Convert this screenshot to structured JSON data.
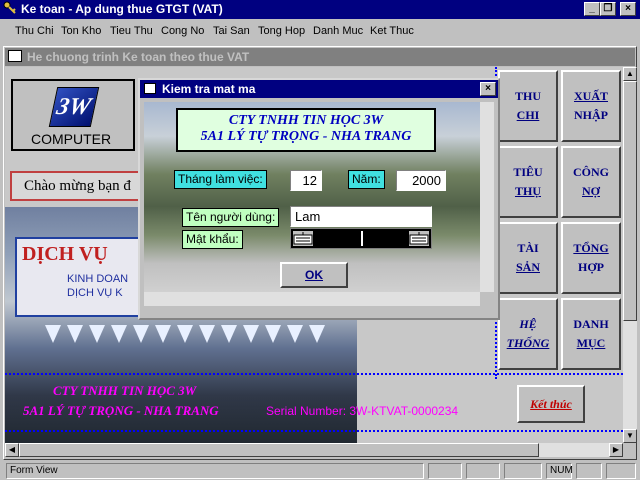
{
  "app": {
    "title": "Ke toan - Ap dung thue GTGT (VAT)"
  },
  "menu": [
    "Thu Chi",
    "Ton Kho",
    "Tieu Thu",
    "Cong No",
    "Tai San",
    "Tong Hop",
    "Danh Muc",
    "Ket Thuc"
  ],
  "form": {
    "title": "He chuong trinh Ke toan theo thue VAT",
    "logo_mark": "3W",
    "logo_text": "COMPUTER",
    "welcome": "Chào mừng bạn đ",
    "photo_sign_big": "DỊCH VỤ",
    "photo_sign_sub1": "KINH DOAN",
    "photo_sign_sub2": "DỊCH VỤ K",
    "company_name": "CTY TNHH TIN HỌC 3W",
    "company_address": "5A1 LÝ TỰ TRỌNG - NHA TRANG",
    "serial": "Serial Number: 3W-KTVAT-0000234",
    "exit_button": "Kết thúc"
  },
  "nav_buttons": [
    {
      "line1": "THU",
      "line2": "CHI"
    },
    {
      "line1": "XUẤT",
      "line2": "NHẬP"
    },
    {
      "line1": "TIÊU",
      "line2": "THỤ"
    },
    {
      "line1": "CÔNG",
      "line2": "NỢ"
    },
    {
      "line1": "TÀI",
      "line2": "SẢN"
    },
    {
      "line1": "TỔNG",
      "line2": "HỢP"
    },
    {
      "line1": "HỆ",
      "line2": "THỐNG"
    },
    {
      "line1": "DANH",
      "line2": "MỤC"
    }
  ],
  "dialog": {
    "title": "Kiem tra mat ma",
    "company_line1": "CTY TNHH TIN HỌC 3W",
    "company_line2": "5A1 LÝ TỰ TRỌNG - NHA TRANG",
    "month_label": "Tháng làm việc:",
    "month_value": "12",
    "year_label": "Năm:",
    "year_value": "2000",
    "user_label": "Tên người dùng:",
    "user_value": "Lam",
    "password_label": "Mật khẩu:",
    "ok_label": "OK"
  },
  "status": {
    "mode": "Form View",
    "num": "NUM"
  }
}
